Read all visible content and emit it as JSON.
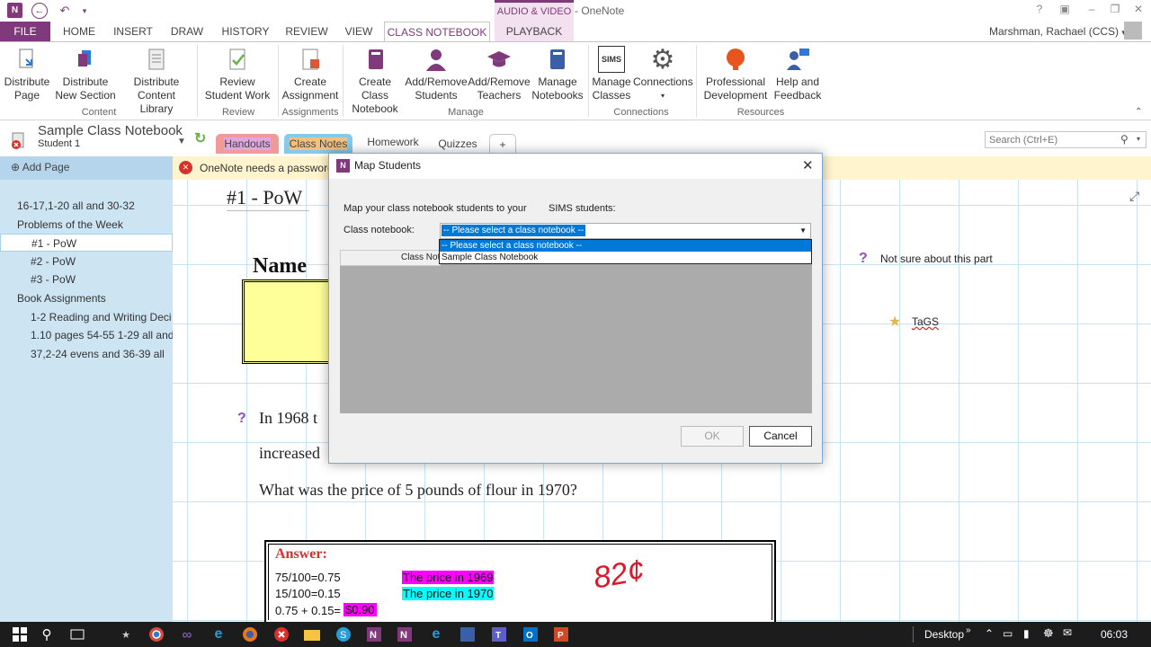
{
  "window": {
    "title": "#1 - PoW - OneNote",
    "contextual_label": "AUDIO & VIDEO",
    "help": "?",
    "user": "Marshman, Rachael (CCS)"
  },
  "tabs": [
    "FILE",
    "HOME",
    "INSERT",
    "DRAW",
    "HISTORY",
    "REVIEW",
    "VIEW",
    "CLASS NOTEBOOK",
    "PLAYBACK"
  ],
  "ribbon": {
    "content": {
      "distribute_page": "Distribute Page",
      "distribute_new_section": "Distribute New Section",
      "distribute_content_library": "Distribute Content Library",
      "group": "Content"
    },
    "review": {
      "review_student_work": "Review Student Work",
      "group": "Review"
    },
    "assignments": {
      "create_assignment": "Create Assignment",
      "group": "Assignments"
    },
    "manage": {
      "create_class_notebook": "Create Class Notebook",
      "add_remove_students": "Add/Remove Students",
      "add_remove_teachers": "Add/Remove Teachers",
      "manage_notebooks": "Manage Notebooks",
      "group": "Manage"
    },
    "connections": {
      "manage_classes": "Manage Classes",
      "sims": "SIMS",
      "connections": "Connections",
      "group": "Connections"
    },
    "resources": {
      "professional_development": "Professional Development",
      "help_feedback": "Help and Feedback",
      "group": "Resources"
    }
  },
  "notebook": {
    "name": "Sample Class Notebook",
    "section_label": "Student 1",
    "sync_icon": "sync-icon"
  },
  "section_tabs": [
    {
      "label": "Handouts",
      "color": "#f29a9a"
    },
    {
      "label": "Class Notes",
      "color": "#e0a6e0"
    },
    {
      "label": "Homework",
      "color": "#86c9e8"
    },
    {
      "label": "Quizzes",
      "color": "#f5c07d"
    },
    {
      "label": "+",
      "color": "#ffffff"
    }
  ],
  "search": {
    "placeholder": "Search (Ctrl+E)"
  },
  "pages": {
    "add_page": "Add Page",
    "items": [
      {
        "label": "16-17,1-20 all and 30-32",
        "indent": 0
      },
      {
        "label": "Problems of the Week",
        "indent": 0
      },
      {
        "label": "#1 - PoW",
        "indent": 1,
        "selected": true
      },
      {
        "label": "#2 - PoW",
        "indent": 1
      },
      {
        "label": "#3 - PoW",
        "indent": 1
      },
      {
        "label": "Book Assignments",
        "indent": 0
      },
      {
        "label": "1-2 Reading and Writing Deci",
        "indent": 1
      },
      {
        "label": "1.10 pages 54-55 1-29 all and",
        "indent": 1
      },
      {
        "label": "37,2-24 evens and 36-39 all",
        "indent": 1
      }
    ]
  },
  "notice": "OneNote needs a password to",
  "page": {
    "title": "#1 - PoW",
    "name_label": "Name",
    "tag_question": "Not sure about this part",
    "tag_star": "TaGS",
    "q_line1": "In 1968 t",
    "q_line2": "increased",
    "q_line3": "What was the price of 5 pounds of flour in 1970?",
    "answer_label": "Answer:",
    "ans_rows": [
      "75/100=0.75",
      "15/100=0.15",
      "0.75 + 0.15="
    ],
    "ans_result": "$0.90",
    "highlight_1969": "The price in 1969",
    "highlight_1970": "The price in 1970",
    "handwritten": "82¢"
  },
  "dialog": {
    "title": "Map Students",
    "desc_left": "Map your class notebook students to your",
    "desc_right": "SIMS students:",
    "class_label": "Class notebook:",
    "select_value": "-- Please select a class notebook --",
    "options": [
      "-- Please select a class notebook --",
      "Sample Class Notebook"
    ],
    "col_header": "Class Not",
    "ok": "OK",
    "cancel": "Cancel"
  },
  "taskbar": {
    "desktop": "Desktop",
    "time": "06:03"
  }
}
